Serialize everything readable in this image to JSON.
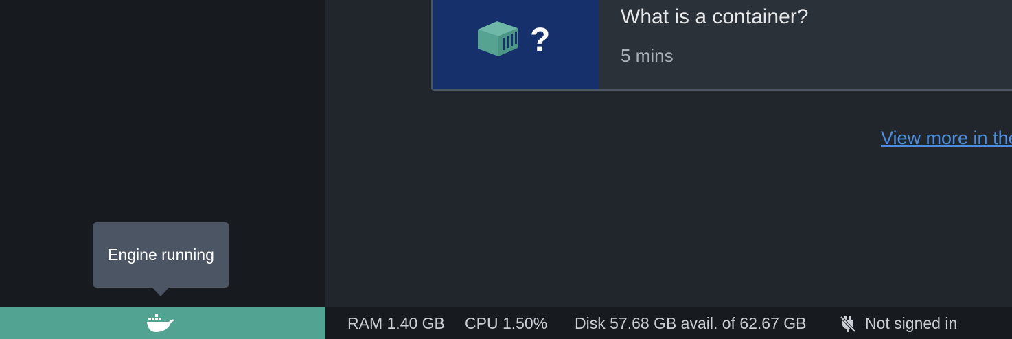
{
  "card": {
    "title": "What is a container?",
    "duration": "5 mins"
  },
  "view_more": "View more in the Learning center",
  "tooltip": {
    "text": "Engine running"
  },
  "statusbar": {
    "ram": "RAM 1.40 GB",
    "cpu": "CPU 1.50%",
    "disk": "Disk 57.68 GB avail. of 62.67 GB",
    "signin": "Not signed in"
  },
  "icons": {
    "container": "container-question-icon",
    "engine": "docker-whale-icon",
    "signin": "unplugged-icon"
  },
  "colors": {
    "engine_running": "#52a391",
    "card_thumb_bg": "#15306b",
    "link": "#4f8de1"
  }
}
